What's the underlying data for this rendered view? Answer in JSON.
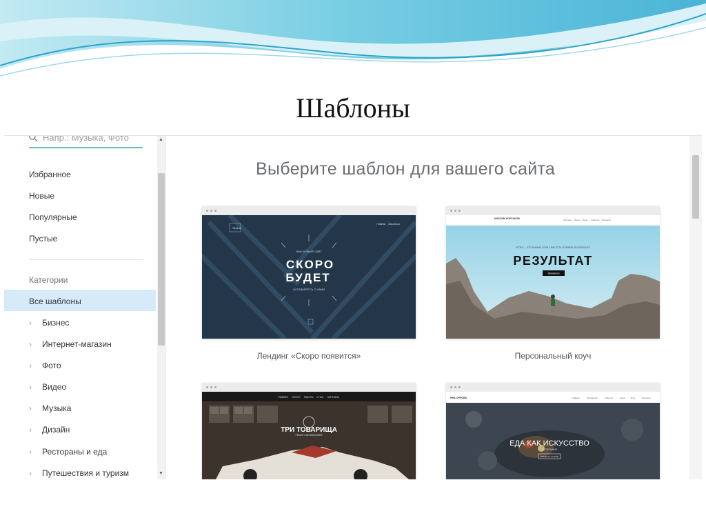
{
  "slide": {
    "title": "Шаблоны"
  },
  "sidebar": {
    "search_placeholder": "Напр.: Музыка, Фото",
    "quick": [
      {
        "label": "Избранное"
      },
      {
        "label": "Новые"
      },
      {
        "label": "Популярные"
      },
      {
        "label": "Пустые"
      }
    ],
    "categories_title": "Категории",
    "active_label": "Все шаблоны",
    "categories": [
      {
        "label": "Бизнес"
      },
      {
        "label": "Интернет-магазин"
      },
      {
        "label": "Фото"
      },
      {
        "label": "Видео"
      },
      {
        "label": "Музыка"
      },
      {
        "label": "Дизайн"
      },
      {
        "label": "Рестораны и еда"
      },
      {
        "label": "Путешествия и туризм"
      }
    ]
  },
  "main": {
    "title": "Выберите шаблон для вашего сайта",
    "templates": [
      {
        "name": "Лендинг «Скоро появится»",
        "preview": {
          "brand": "Skyline",
          "nav1": "Главная",
          "nav2": "Связаться",
          "kicker": "НАШ НОВЫЙ САЙТ",
          "line1": "СКОРО",
          "line2": "БУДЕТ",
          "sub": "ОСТАВАЙТЕСЬ С НАМИ"
        }
      },
      {
        "name": "Персональный коуч",
        "preview": {
          "brand": "МАКСИМ КОРСАКОВ",
          "nav1": "Обо мне",
          "nav2": "Курсы",
          "nav3": "Цели",
          "nav4": "События",
          "nav5": "Контакты",
          "kicker": "УСПЕХ — ЭТО ЗНАНИЕ, ЕСЛИ У ВАС ЕСТЬ УСЛОВИЯ, ВЫ ПОЛУЧИТЕ",
          "headline": "РЕЗУЛЬТАТ",
          "button": "Записаться"
        }
      },
      {
        "name": "",
        "preview": {
          "nav1": "ГЛАВНАЯ",
          "nav2": "УСЛУГИ",
          "nav3": "РАБОТЫ",
          "nav4": "О НАС",
          "nav5": "КОНТАКТЫ",
          "headline": "ТРИ ТОВАРИЩА",
          "sub": "РЕМОНТ АВТОМОБИЛЕЙ"
        }
      },
      {
        "name": "",
        "preview": {
          "brand": "ЯНА ОРЛОВА",
          "nav1": "Главная",
          "nav2": "Портфолио",
          "nav3": "Клиенты",
          "nav4": "Книга",
          "nav5": "Блог",
          "nav6": "Контакты",
          "headline": "ЕДА КАК ИСКУССТВО",
          "sub": "ФОТОГРАФИЯ",
          "button": "Связаться со мной"
        }
      }
    ]
  },
  "colors": {
    "accent": "#5cb8c5",
    "active_bg": "#d6eaf8",
    "wave": "#4db6d8"
  }
}
